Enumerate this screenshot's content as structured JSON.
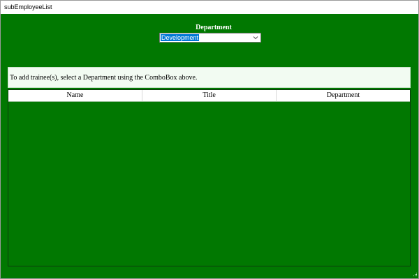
{
  "window": {
    "title": "subEmployeeList"
  },
  "department": {
    "label": "Department",
    "selected": "Development"
  },
  "info": {
    "text": "To add trainee(s), select a Department using the ComboBox above."
  },
  "grid": {
    "columns": [
      "Name",
      "Title",
      "Department"
    ],
    "rows": []
  },
  "colors": {
    "background": "#017801",
    "selection": "#0078d7",
    "panel": "#f2fbf2"
  },
  "icons": {
    "combo_arrow": "chevron-down-icon",
    "resize_grip": "resize-grip-icon"
  }
}
